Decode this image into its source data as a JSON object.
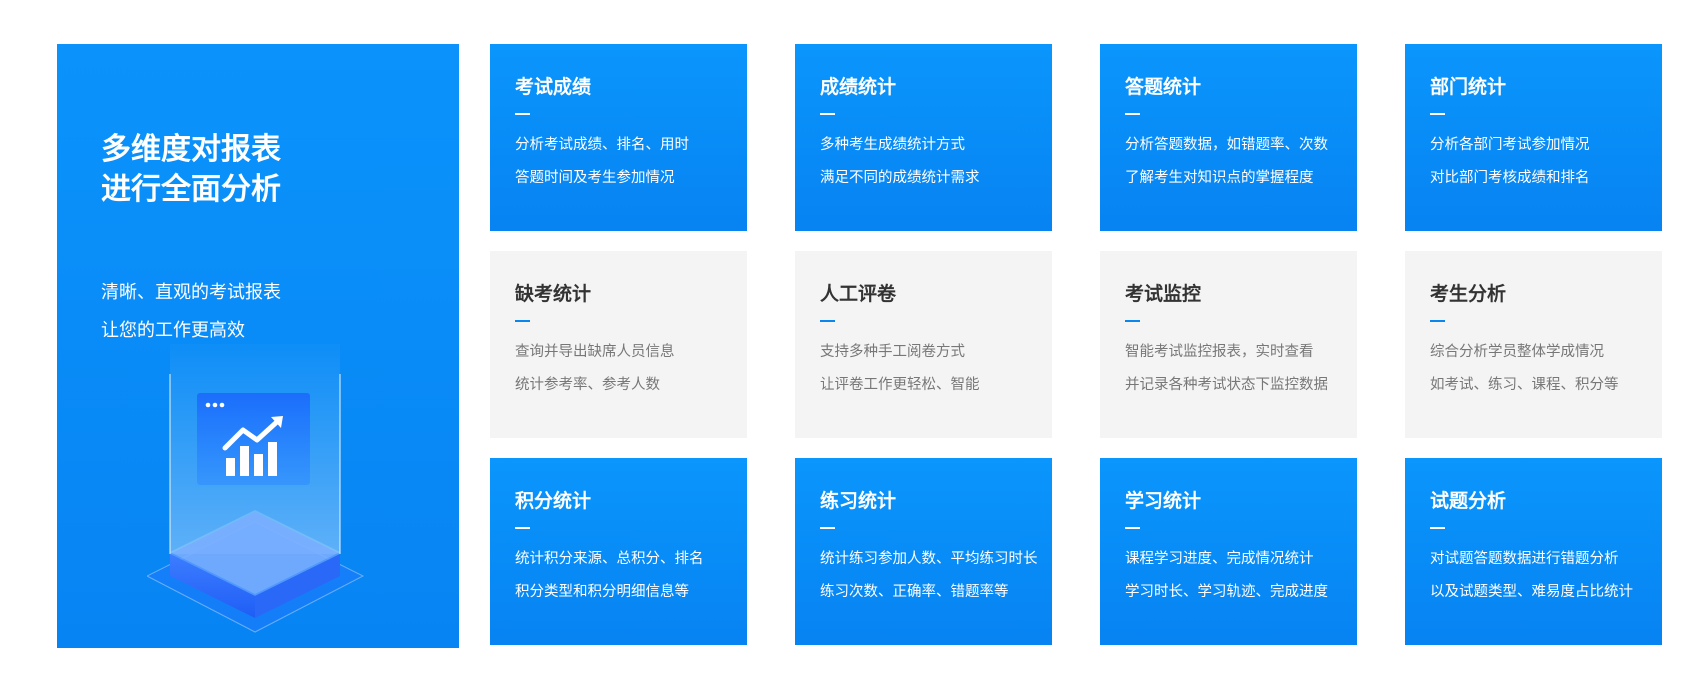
{
  "hero": {
    "title_line1": "多维度对报表",
    "title_line2": "进行全面分析",
    "subtitle_line1": "清晰、直观的考试报表",
    "subtitle_line2": "让您的工作更高效"
  },
  "colors": {
    "accent": "#0a86ef",
    "card_blue": "#0a96fc",
    "card_gray": "#f4f4f4"
  },
  "cards": [
    {
      "title": "考试成绩",
      "line1": "分析考试成绩、排名、用时",
      "line2": "答题时间及考生参加情况",
      "style": "blue"
    },
    {
      "title": "成绩统计",
      "line1": "多种考生成绩统计方式",
      "line2": "满足不同的成绩统计需求",
      "style": "blue"
    },
    {
      "title": "答题统计",
      "line1": "分析答题数据，如错题率、次数",
      "line2": "了解考生对知识点的掌握程度",
      "style": "blue"
    },
    {
      "title": "部门统计",
      "line1": "分析各部门考试参加情况",
      "line2": "对比部门考核成绩和排名",
      "style": "blue"
    },
    {
      "title": "缺考统计",
      "line1": "查询并导出缺席人员信息",
      "line2": "统计参考率、参考人数",
      "style": "gray"
    },
    {
      "title": "人工评卷",
      "line1": "支持多种手工阅卷方式",
      "line2": "让评卷工作更轻松、智能",
      "style": "gray"
    },
    {
      "title": "考试监控",
      "line1": "智能考试监控报表，实时查看",
      "line2": "并记录各种考试状态下监控数据",
      "style": "gray"
    },
    {
      "title": "考生分析",
      "line1": "综合分析学员整体学成情况",
      "line2": "如考试、练习、课程、积分等",
      "style": "gray"
    },
    {
      "title": "积分统计",
      "line1": "统计积分来源、总积分、排名",
      "line2": "积分类型和积分明细信息等",
      "style": "blue"
    },
    {
      "title": "练习统计",
      "line1": "统计练习参加人数、平均练习时长",
      "line2": "练习次数、正确率、错题率等",
      "style": "blue"
    },
    {
      "title": "学习统计",
      "line1": "课程学习进度、完成情况统计",
      "line2": "学习时长、学习轨迹、完成进度",
      "style": "blue"
    },
    {
      "title": "试题分析",
      "line1": "对试题答题数据进行错题分析",
      "line2": "以及试题类型、难易度占比统计",
      "style": "blue"
    }
  ]
}
